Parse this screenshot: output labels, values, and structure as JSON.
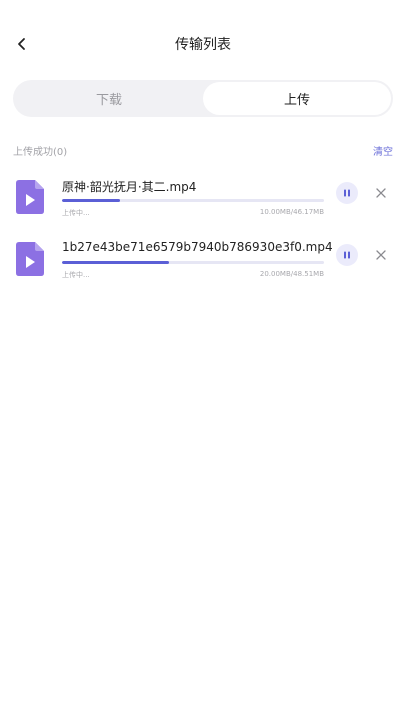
{
  "header": {
    "title": "传输列表",
    "back_icon": "chevron-left-icon"
  },
  "tabs": [
    {
      "label": "下载",
      "active": false
    },
    {
      "label": "上传",
      "active": true
    }
  ],
  "section": {
    "label": "上传成功(0)",
    "clear_label": "清空"
  },
  "uploads": [
    {
      "name": "原神·韶光抚月·其二.mp4",
      "status": "上传中...",
      "size": "10.00MB/46.17MB",
      "progress": 0.22
    },
    {
      "name": "1b27e43be71e6579b7940b786930e3f0.mp4",
      "status": "上传中...",
      "size": "20.00MB/48.51MB",
      "progress": 0.41
    }
  ],
  "colors": {
    "accent": "#5b5fd6",
    "file_icon": "#8c70e3",
    "pause_bg": "#ebebfb"
  }
}
